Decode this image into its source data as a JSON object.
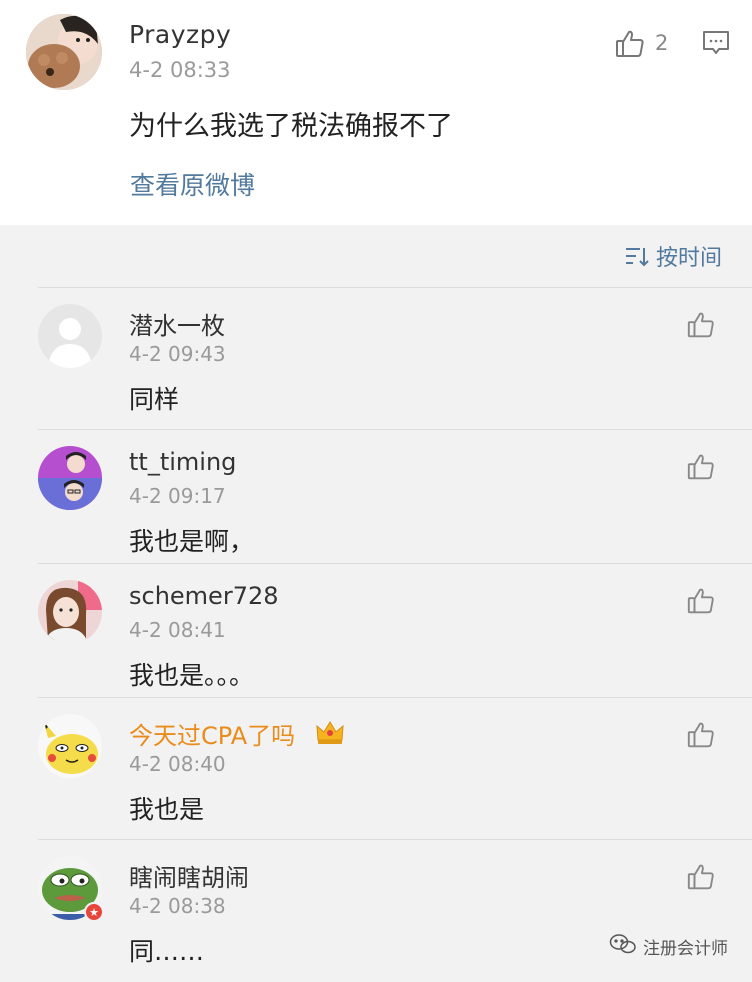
{
  "post": {
    "username": "Prayzpy",
    "time": "4-2 08:33",
    "text": "为什么我选了税法确报不了",
    "like_count": "2",
    "view_original": "查看原微博",
    "avatar_icon": "user-avatar-girl-with-dog"
  },
  "sort": {
    "label": "按时间",
    "icon": "sort-icon"
  },
  "comments": [
    {
      "username": "潜水一枚",
      "time": "4-2 09:43",
      "text": "同样",
      "avatar_icon": "default-avatar"
    },
    {
      "username": "tt_timing",
      "time": "4-2 09:17",
      "text": "我也是啊，",
      "avatar_icon": "two-boys-avatar"
    },
    {
      "username": "schemer728",
      "time": "4-2 08:41",
      "text": "我也是。。。",
      "avatar_icon": "girl-avatar"
    },
    {
      "username": "今天过CPA了吗",
      "time": "4-2 08:40",
      "text": "我也是",
      "avatar_icon": "pikachu-avatar",
      "vip": true
    },
    {
      "username": "瞎闹瞎胡闹",
      "time": "4-2 08:38",
      "text": "同……",
      "avatar_icon": "pepe-frog-avatar"
    }
  ],
  "watermark": {
    "text": "注册会计师",
    "icon": "wechat-icon"
  },
  "colors": {
    "link": "#52799e",
    "vip_name": "#ea8c1b",
    "background": "#f2f2f2"
  }
}
